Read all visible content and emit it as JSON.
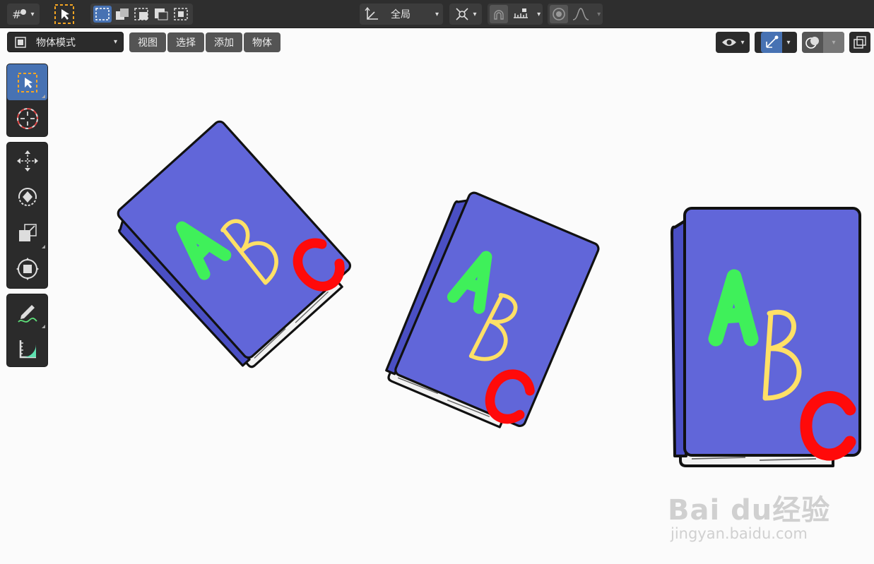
{
  "topbar": {
    "transform_orientation": "全局"
  },
  "header": {
    "mode_label": "物体模式",
    "menus": [
      "视图",
      "选择",
      "添加",
      "物体"
    ]
  },
  "toolbar": {
    "tools": [
      "select-box",
      "cursor",
      "move",
      "rotate",
      "scale",
      "transform",
      "annotate",
      "measure"
    ]
  },
  "scene": {
    "book_letters": [
      "A",
      "B",
      "C"
    ],
    "colors": {
      "cover": "#6166d9",
      "spine": "#4a4fc4",
      "letter_a": "#3ff05a",
      "letter_b": "#ffe066",
      "letter_c": "#ff0a0a"
    }
  },
  "watermark": {
    "logo_text": "Bai du经验",
    "url": "jingyan.baidu.com"
  },
  "colors": {
    "topbar_bg": "#2e2e2e",
    "accent": "#4772b3",
    "viewport_bg": "#fbfbfb"
  }
}
